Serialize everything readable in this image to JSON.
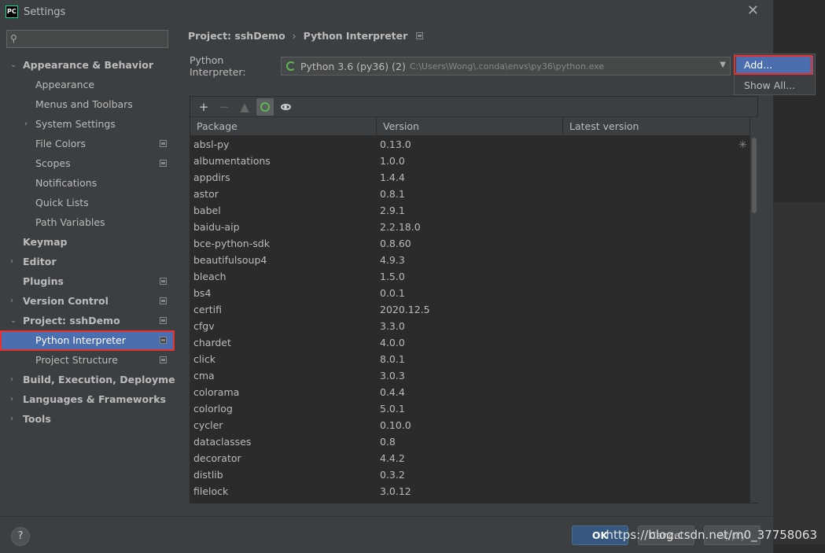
{
  "window": {
    "title": "Settings",
    "logo_text": "PC"
  },
  "sidebar": {
    "search_placeholder": "",
    "items": [
      {
        "label": "Appearance & Behavior",
        "level": 0,
        "expanded": true
      },
      {
        "label": "Appearance",
        "level": 1
      },
      {
        "label": "Menus and Toolbars",
        "level": 1
      },
      {
        "label": "System Settings",
        "level": 1,
        "collapsed": true
      },
      {
        "label": "File Colors",
        "level": 1
      },
      {
        "label": "Scopes",
        "level": 1
      },
      {
        "label": "Notifications",
        "level": 1
      },
      {
        "label": "Quick Lists",
        "level": 1
      },
      {
        "label": "Path Variables",
        "level": 1
      },
      {
        "label": "Keymap",
        "level": 0
      },
      {
        "label": "Editor",
        "level": 0,
        "collapsed": true
      },
      {
        "label": "Plugins",
        "level": 0
      },
      {
        "label": "Version Control",
        "level": 0,
        "collapsed": true
      },
      {
        "label": "Project: sshDemo",
        "level": 0,
        "expanded": true
      },
      {
        "label": "Python Interpreter",
        "level": 1,
        "selected": true
      },
      {
        "label": "Project Structure",
        "level": 1
      },
      {
        "label": "Build, Execution, Deployment",
        "level": 0,
        "collapsed": true
      },
      {
        "label": "Languages & Frameworks",
        "level": 0,
        "collapsed": true
      },
      {
        "label": "Tools",
        "level": 0,
        "collapsed": true
      }
    ]
  },
  "breadcrumb": {
    "project": "Project: sshDemo",
    "separator": "›",
    "page": "Python Interpreter"
  },
  "interpreter": {
    "label": "Python Interpreter:",
    "name": "Python 3.6 (py36) (2)",
    "path": "C:\\Users\\Wong\\.conda\\envs\\py36\\python.exe"
  },
  "popup": {
    "add": "Add...",
    "show_all": "Show All..."
  },
  "table": {
    "headers": [
      "Package",
      "Version",
      "Latest version"
    ],
    "rows": [
      [
        "absl-py",
        "0.13.0"
      ],
      [
        "albumentations",
        "1.0.0"
      ],
      [
        "appdirs",
        "1.4.4"
      ],
      [
        "astor",
        "0.8.1"
      ],
      [
        "babel",
        "2.9.1"
      ],
      [
        "baidu-aip",
        "2.2.18.0"
      ],
      [
        "bce-python-sdk",
        "0.8.60"
      ],
      [
        "beautifulsoup4",
        "4.9.3"
      ],
      [
        "bleach",
        "1.5.0"
      ],
      [
        "bs4",
        "0.0.1"
      ],
      [
        "certifi",
        "2020.12.5"
      ],
      [
        "cfgv",
        "3.3.0"
      ],
      [
        "chardet",
        "4.0.0"
      ],
      [
        "click",
        "8.0.1"
      ],
      [
        "cma",
        "3.0.3"
      ],
      [
        "colorama",
        "0.4.4"
      ],
      [
        "colorlog",
        "5.0.1"
      ],
      [
        "cycler",
        "0.10.0"
      ],
      [
        "dataclasses",
        "0.8"
      ],
      [
        "decorator",
        "4.4.2"
      ],
      [
        "distlib",
        "0.3.2"
      ],
      [
        "filelock",
        "3.0.12"
      ]
    ]
  },
  "footer": {
    "help": "?",
    "ok": "OK",
    "cancel": "Cancel",
    "apply": "Apply"
  },
  "watermark": "https://blog.csdn.net/m0_37758063",
  "colors": {
    "selection": "#4b6eaf",
    "highlight_box": "#e8302c",
    "spinner": "#5fb84f"
  }
}
